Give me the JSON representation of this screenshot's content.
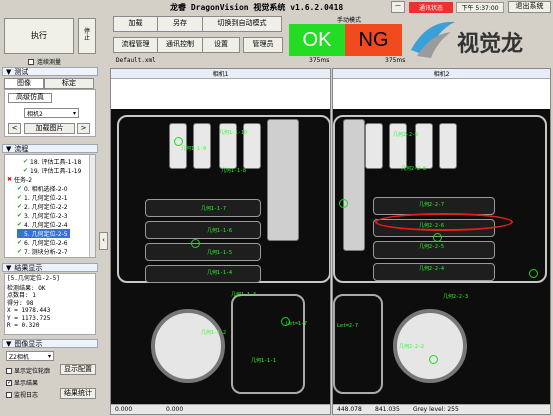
{
  "window": {
    "title": "龙睿 DragonVision 视觉系统 v1.6.2.0418"
  },
  "status": {
    "comm": "通讯状态",
    "clock": "下午 5:37:00",
    "exit": "退出系统",
    "dash": "－"
  },
  "left_top": {
    "run": "执行",
    "stop": "连续测量"
  },
  "toolbar": {
    "load": "加载",
    "save_as": "另存",
    "switch_auto": "切换到自动模式",
    "flow_manage": "流程管理",
    "comm_control": "通讯控制",
    "settings": "设置",
    "admin": "管理员"
  },
  "mode": {
    "label": "手动模式",
    "ok": "OK",
    "ng": "NG",
    "time_left": "375ms",
    "time_right": "375ms"
  },
  "logo": {
    "text": "视觉龙"
  },
  "file": {
    "name": "Default.xml"
  },
  "test_section": {
    "title": "测试",
    "tabs": [
      "图像",
      "标定"
    ],
    "subtab": "高级仿真",
    "camera": "相机2",
    "prev": "<",
    "next": ">",
    "load_image": "加载图片"
  },
  "flow_section": {
    "title": "流程",
    "items": [
      "18. 评估工具-1-18",
      "19. 评估工具-1-19",
      "任务-2",
      "0. 相机选择-2-0",
      "1. 几何定位-2-1",
      "2. 几何定位-2-2",
      "3. 几何定位-2-3",
      "4. 几何定位-2-4",
      "5. 几何定位-2-5",
      "6. 几何定位-2-6",
      "7. 测块分析-2-7"
    ]
  },
  "result_section": {
    "title": "结果显示",
    "header": "[5.几何定位-2-5]",
    "lines": [
      "检测结果: OK",
      "点数目: 1",
      "得分: 98",
      "X = 1978.443",
      "Y = 1173.725",
      "R = 0.320"
    ]
  },
  "image_section": {
    "title": "图像显示",
    "camera": "Z2相机",
    "opt1": "显示定位轮廓",
    "opt2": "显示结果",
    "opt3": "监视日志",
    "btn_config": "显示配置",
    "btn_stats": "结果统计"
  },
  "viewers": {
    "left_title": "相机1",
    "right_title": "相机2",
    "left_status": [
      "0.000",
      "0.000"
    ],
    "right_status": [
      "448.078",
      "841.035",
      "Grey level: 255"
    ]
  },
  "overlay": {
    "left_labels": [
      "几何1-1-10",
      "几何1-1-9",
      "几何1-1-8",
      "几何1-1-7",
      "几何1-1-6",
      "几何1-1-5",
      "几何1-1-4",
      "几何1-1-3",
      "几何1-1-2",
      "几何1-1-1",
      "Let=1-7"
    ],
    "right_labels": [
      "几何2-2-9",
      "几何2-2-8",
      "几何2-2-7",
      "几何2-2-6",
      "几何2-2-5",
      "几何2-2-4",
      "几何2-2-3",
      "几何2-2-2",
      "Let=2-7"
    ]
  },
  "colors": {
    "ok_green": "#23dc23",
    "ng_orange": "#f14a1f",
    "overlay_green": "#28ff28",
    "ellipse_red": "#e0201a"
  }
}
